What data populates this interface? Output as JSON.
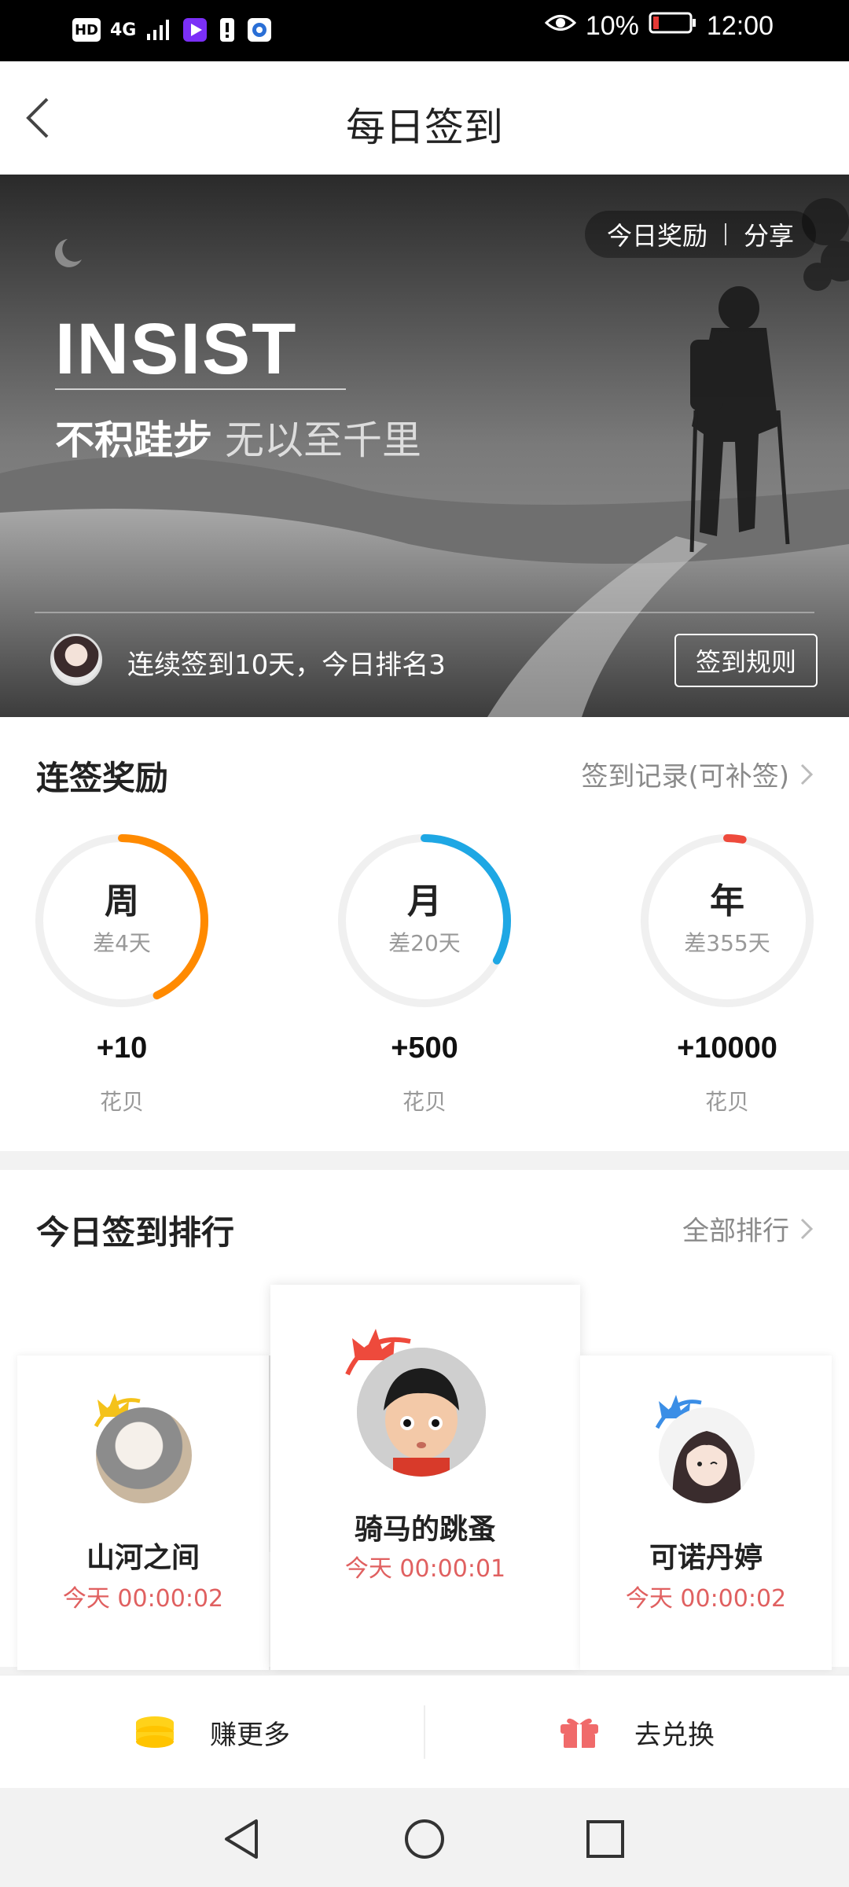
{
  "status_bar": {
    "hd": "HD",
    "network": "4G",
    "battery_percent": "10%",
    "time": "12:00"
  },
  "header": {
    "title": "每日签到",
    "back_icon": "chevron-left-icon"
  },
  "banner": {
    "actions": {
      "reward": "今日奖励",
      "share": "分享"
    },
    "headline": "INSIST",
    "motto_strong": "不积跬步",
    "motto_light": "无以至千里",
    "streak_text": "连续签到10天，今日排名3",
    "rules_button": "签到规则"
  },
  "rewards": {
    "title": "连签奖励",
    "link": "签到记录(可补签)",
    "items": [
      {
        "period": "周",
        "remaining": "差4天",
        "amount": "+10",
        "unit": "花贝",
        "color": "#ff8a00",
        "progress": 0.43
      },
      {
        "period": "月",
        "remaining": "差20天",
        "amount": "+500",
        "unit": "花贝",
        "color": "#1ea7e4",
        "progress": 0.33
      },
      {
        "period": "年",
        "remaining": "差355天",
        "amount": "+10000",
        "unit": "花贝",
        "color": "#ee4a3c",
        "progress": 0.03
      }
    ]
  },
  "ranking": {
    "title": "今日签到排行",
    "link": "全部排行",
    "entries": [
      {
        "rank": 2,
        "name": "山河之间",
        "time": "今天 00:00:02",
        "crown_color": "#f4c21a"
      },
      {
        "rank": 1,
        "name": "骑马的跳蚤",
        "time": "今天 00:00:01",
        "crown_color": "#ee4a3c"
      },
      {
        "rank": 3,
        "name": "可诺丹婷",
        "time": "今天 00:00:02",
        "crown_color": "#3b8ee6"
      }
    ]
  },
  "actions": {
    "earn": {
      "label": "赚更多",
      "icon": "coin-stack-icon",
      "color": "#ffd21a"
    },
    "exchange": {
      "label": "去兑换",
      "icon": "gift-icon",
      "color": "#f06a6a"
    }
  }
}
